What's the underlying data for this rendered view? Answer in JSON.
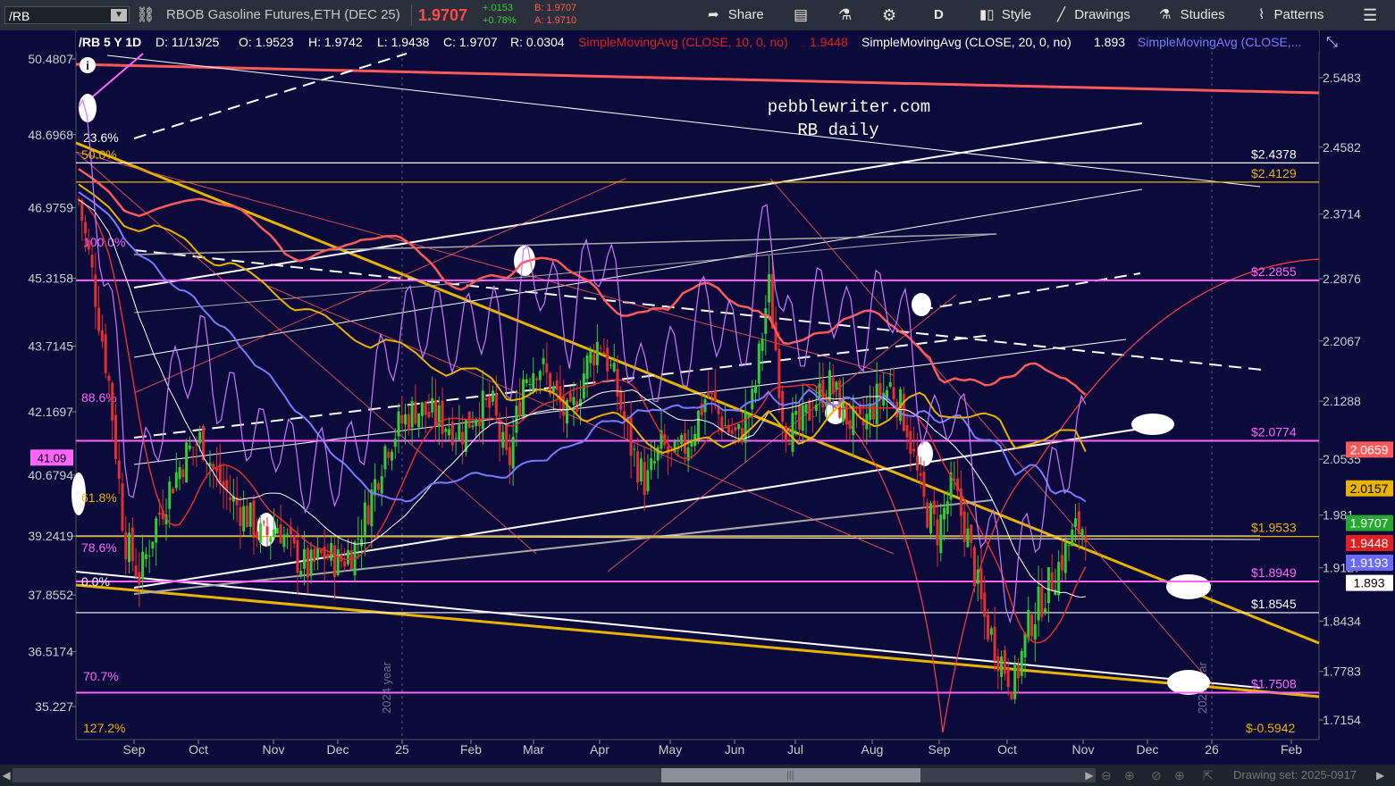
{
  "toolbar": {
    "symbol": "/RB",
    "description": "RBOB Gasoline Futures,ETH (DEC 25)",
    "last": "1.9707",
    "change": "+.0153",
    "change_pct": "+0.78%",
    "bid": "B: 1.9707",
    "ask": "A: 1.9710",
    "share": "Share",
    "timeframe": "D",
    "style": "Style",
    "drawings": "Drawings",
    "studies": "Studies",
    "patterns": "Patterns"
  },
  "header": {
    "instrument": "/RB 5 Y 1D",
    "date": "D: 11/13/25",
    "open": "O: 1.9523",
    "high": "H: 1.9742",
    "low": "L: 1.9438",
    "close": "C: 1.9707",
    "range": "R: 0.0304",
    "sma10_label": "SimpleMovingAvg (CLOSE, 10, 0, no)",
    "sma10_value": "1.9448",
    "sma20_label": "SimpleMovingAvg (CLOSE, 20, 0, no)",
    "sma20_value": "1.893",
    "sma50_label": "SimpleMovingAvg (CLOSE,..."
  },
  "annotations": {
    "site": "pebblewriter.com",
    "subtitle": "RB daily"
  },
  "status": {
    "drawing_set": "Drawing set: 2025-0917"
  },
  "colors": {
    "background": "#0b0a3a",
    "sma10": "#e03030",
    "sma20": "#ffffff",
    "sma50": "#7a7aff",
    "sma100": "#e8b400",
    "sma200": "#ff5a5a",
    "rsi": "#cc77ff",
    "fib": "#ff66ff",
    "gold": "#e8b400",
    "up": "#33cc33",
    "down": "#e03030"
  },
  "chart_data": {
    "type": "candlestick",
    "title": "/RB 5 Y 1D",
    "x_ticks": [
      "Sep",
      "Oct",
      "Nov",
      "Dec",
      "25",
      "Feb",
      "Mar",
      "Apr",
      "May",
      "Jun",
      "Jul",
      "Aug",
      "Sep",
      "Oct",
      "Nov",
      "Dec",
      "26",
      "Feb"
    ],
    "year_markers": [
      "2024 year",
      "2025 year"
    ],
    "y_ticks": [
      "2.5483",
      "2.4582",
      "2.3714",
      "2.2876",
      "2.2067",
      "2.1288",
      "2.0535",
      "1.981",
      "1.9127",
      "1.8434",
      "1.7783",
      "1.7154"
    ],
    "left_ticks": [
      "50.4807",
      "48.6968",
      "46.9759",
      "45.3158",
      "43.7145",
      "42.1697",
      "40.6794",
      "39.2419",
      "37.8552",
      "36.5174",
      "35.227"
    ],
    "rsi_value": "41.09",
    "levels": [
      {
        "price": 2.4378,
        "label": "$2.4378",
        "color": "#ffffff"
      },
      {
        "price": 2.4129,
        "label": "$2.4129",
        "color": "#e8b400"
      },
      {
        "price": 2.2855,
        "label": "$2.2855",
        "color": "#ff66ff"
      },
      {
        "price": 2.0774,
        "label": "$2.0774",
        "color": "#ff66ff"
      },
      {
        "price": 1.9533,
        "label": "$1.9533",
        "color": "#e8b400"
      },
      {
        "price": 1.8949,
        "label": "$1.8949",
        "color": "#ff66ff"
      },
      {
        "price": 1.8545,
        "label": "$1.8545",
        "color": "#ffffff"
      },
      {
        "price": 1.7508,
        "label": "$1.7508",
        "color": "#ff66ff"
      }
    ],
    "fib_labels": [
      "23.6%",
      "50.0%",
      "100.0%",
      "88.6%",
      "61.8%",
      "78.6%",
      "0.0%",
      "70.7%",
      "127.2%"
    ],
    "bottom_label": "$-0.5942",
    "price_tags": [
      {
        "label": "2.0659",
        "price": 2.0659,
        "color": "#ff5a5a",
        "text": "#ffffff"
      },
      {
        "label": "2.0157",
        "price": 2.0157,
        "color": "#e8b400",
        "text": "#000000"
      },
      {
        "label": "1.9707",
        "price": 1.9707,
        "color": "#27a830",
        "text": "#ffffff"
      },
      {
        "label": "1.9448",
        "price": 1.9448,
        "color": "#e02020",
        "text": "#ffffff"
      },
      {
        "label": "1.9193",
        "price": 1.9193,
        "color": "#6a6aff",
        "text": "#ffffff"
      },
      {
        "label": "1.893",
        "price": 1.893,
        "color": "#ffffff",
        "text": "#000000"
      }
    ],
    "close_path": [
      [
        0,
        2.39
      ],
      [
        0.015,
        2.28
      ],
      [
        0.03,
        2.15
      ],
      [
        0.045,
        1.95
      ],
      [
        0.06,
        1.9
      ],
      [
        0.075,
        1.97
      ],
      [
        0.09,
        2.02
      ],
      [
        0.105,
        2.06
      ],
      [
        0.12,
        2.08
      ],
      [
        0.135,
        2.03
      ],
      [
        0.15,
        2.0
      ],
      [
        0.165,
        1.98
      ],
      [
        0.18,
        1.95
      ],
      [
        0.195,
        1.97
      ],
      [
        0.21,
        1.93
      ],
      [
        0.225,
        1.91
      ],
      [
        0.24,
        1.93
      ],
      [
        0.255,
        1.92
      ],
      [
        0.27,
        1.94
      ],
      [
        0.285,
        2.0
      ],
      [
        0.3,
        2.07
      ],
      [
        0.315,
        2.1
      ],
      [
        0.33,
        2.12
      ],
      [
        0.345,
        2.11
      ],
      [
        0.36,
        2.1
      ],
      [
        0.375,
        2.09
      ],
      [
        0.39,
        2.12
      ],
      [
        0.405,
        2.12
      ],
      [
        0.42,
        2.04
      ],
      [
        0.435,
        2.16
      ],
      [
        0.45,
        2.18
      ],
      [
        0.465,
        2.14
      ],
      [
        0.48,
        2.1
      ],
      [
        0.495,
        2.17
      ],
      [
        0.51,
        2.21
      ],
      [
        0.525,
        2.15
      ],
      [
        0.54,
        2.07
      ],
      [
        0.555,
        2.02
      ],
      [
        0.57,
        2.07
      ],
      [
        0.585,
        2.05
      ],
      [
        0.6,
        2.09
      ],
      [
        0.615,
        2.14
      ],
      [
        0.63,
        2.1
      ],
      [
        0.645,
        2.08
      ],
      [
        0.66,
        2.13
      ],
      [
        0.675,
        2.28
      ],
      [
        0.69,
        2.1
      ],
      [
        0.705,
        2.09
      ],
      [
        0.72,
        2.13
      ],
      [
        0.735,
        2.15
      ],
      [
        0.75,
        2.11
      ],
      [
        0.765,
        2.09
      ],
      [
        0.78,
        2.13
      ],
      [
        0.795,
        2.15
      ],
      [
        0.81,
        2.1
      ],
      [
        0.825,
        2.0
      ],
      [
        0.84,
        1.96
      ],
      [
        0.855,
        2.02
      ],
      [
        0.87,
        1.95
      ],
      [
        0.885,
        1.85
      ],
      [
        0.9,
        1.8
      ],
      [
        0.915,
        1.76
      ],
      [
        0.93,
        1.84
      ],
      [
        0.945,
        1.88
      ],
      [
        0.96,
        1.92
      ],
      [
        0.975,
        1.96
      ],
      [
        0.985,
        1.97
      ]
    ]
  }
}
